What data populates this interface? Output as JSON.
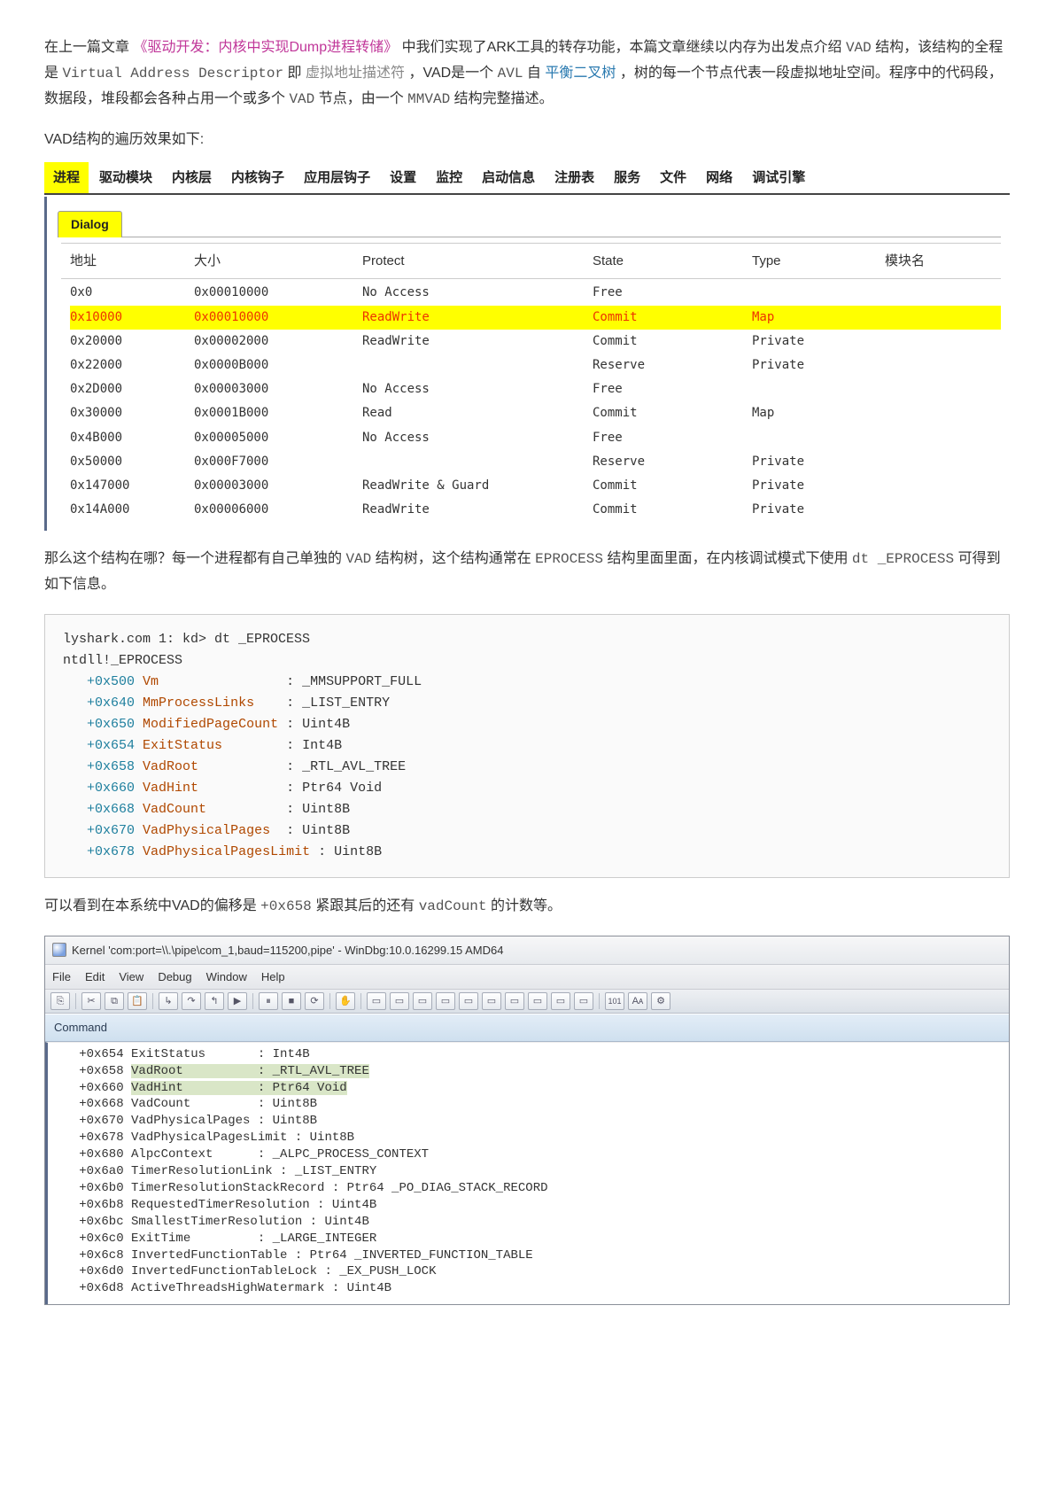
{
  "intro": {
    "line1_a": "在上一篇文章 ",
    "line1_link": "《驱动开发：内核中实现Dump进程转储》",
    "line1_b": " 中我们实现了ARK工具的转存功能，本篇文章继续以内存为出发点介绍 ",
    "vad_code": "VAD",
    "line1_c": " 结构，该结构的全程是 ",
    "vad_full": "Virtual Address Descriptor",
    "line1_d": " 即 ",
    "vad_cn": "虚拟地址描述符",
    "line1_e": " ，VAD是一个 ",
    "avl": "AVL",
    "line1_f": " 自 ",
    "balance_tree": "平衡二叉树",
    "line1_g": " ，树的每一个节点代表一段虚拟地址空间。程序中的代码段，数据段，堆段都会各种占用一个或多个 ",
    "vad_code2": "VAD",
    "line1_h": " 节点，由一个 ",
    "mmvad": "MMVAD",
    "line1_i": " 结构完整描述。"
  },
  "sub_title": "VAD结构的遍历效果如下:",
  "tabs": {
    "active": "进程",
    "items": [
      "驱动模块",
      "内核层",
      "内核钩子",
      "应用层钩子",
      "设置",
      "监控",
      "启动信息",
      "注册表",
      "服务",
      "文件",
      "网络",
      "调试引擎"
    ]
  },
  "dialog_tab": "Dialog",
  "grid": {
    "headers": [
      "地址",
      "大小",
      "Protect",
      "State",
      "Type",
      "模块名"
    ],
    "rows": [
      {
        "addr": "0x0",
        "size": "0x00010000",
        "protect": "No Access",
        "state": "Free",
        "type": "",
        "hl": false
      },
      {
        "addr": "0x10000",
        "size": "0x00010000",
        "protect": "ReadWrite",
        "state": "Commit",
        "type": "Map",
        "hl": true
      },
      {
        "addr": "0x20000",
        "size": "0x00002000",
        "protect": "ReadWrite",
        "state": "Commit",
        "type": "Private",
        "hl": false
      },
      {
        "addr": "0x22000",
        "size": "0x0000B000",
        "protect": "",
        "state": "Reserve",
        "type": "Private",
        "hl": false
      },
      {
        "addr": "0x2D000",
        "size": "0x00003000",
        "protect": "No Access",
        "state": "Free",
        "type": "",
        "hl": false
      },
      {
        "addr": "0x30000",
        "size": "0x0001B000",
        "protect": "Read",
        "state": "Commit",
        "type": "Map",
        "hl": false
      },
      {
        "addr": "0x4B000",
        "size": "0x00005000",
        "protect": "No Access",
        "state": "Free",
        "type": "",
        "hl": false
      },
      {
        "addr": "0x50000",
        "size": "0x000F7000",
        "protect": "",
        "state": "Reserve",
        "type": "Private",
        "hl": false
      },
      {
        "addr": "0x147000",
        "size": "0x00003000",
        "protect": "ReadWrite & Guard",
        "state": "Commit",
        "type": "Private",
        "hl": false
      },
      {
        "addr": "0x14A000",
        "size": "0x00006000",
        "protect": "ReadWrite",
        "state": "Commit",
        "type": "Private",
        "hl": false
      }
    ]
  },
  "para2": {
    "a": "那么这个结构在哪？每一个进程都有自己单独的 ",
    "vad": "VAD",
    "b": " 结构树，这个结构通常在 ",
    "eproc": "EPROCESS",
    "c": " 结构里面里面，在内核调试模式下使用 ",
    "dt": "dt _EPROCESS",
    "d": " 可得到如下信息。"
  },
  "code": {
    "l1": "lyshark.com 1: kd> dt _EPROCESS",
    "l2": "ntdll!_EPROCESS",
    "e": [
      {
        "off": "+0x500",
        "name": "Vm",
        "type": ": _MMSUPPORT_FULL"
      },
      {
        "off": "+0x640",
        "name": "MmProcessLinks",
        "type": ": _LIST_ENTRY"
      },
      {
        "off": "+0x650",
        "name": "ModifiedPageCount",
        "type": ": Uint4B"
      },
      {
        "off": "+0x654",
        "name": "ExitStatus",
        "type": ": Int4B"
      },
      {
        "off": "+0x658",
        "name": "VadRoot",
        "type": ": _RTL_AVL_TREE"
      },
      {
        "off": "+0x660",
        "name": "VadHint",
        "type": ": Ptr64 Void"
      },
      {
        "off": "+0x668",
        "name": "VadCount",
        "type": ": Uint8B"
      },
      {
        "off": "+0x670",
        "name": "VadPhysicalPages",
        "type": ": Uint8B"
      },
      {
        "off": "+0x678",
        "name": "VadPhysicalPagesLimit",
        "type": ": Uint8B"
      }
    ]
  },
  "para3": {
    "a": "可以看到在本系统中VAD的偏移是 ",
    "off": "+0x658",
    "b": " 紧跟其后的还有 ",
    "vc": "vadCount",
    "c": " 的计数等。"
  },
  "windbg": {
    "title": "Kernel 'com:port=\\\\.\\pipe\\com_1,baud=115200,pipe' - WinDbg:10.0.16299.15 AMD64",
    "menus": [
      "File",
      "Edit",
      "View",
      "Debug",
      "Window",
      "Help"
    ],
    "command_label": "Command",
    "lines": [
      {
        "t": "   +0x654 ExitStatus       : Int4B"
      },
      {
        "t": "   +0x658 VadRoot          : _RTL_AVL_TREE",
        "hl": true
      },
      {
        "t": "   +0x660 VadHint          : Ptr64 Void",
        "hl": true
      },
      {
        "t": "   +0x668 VadCount         : Uint8B"
      },
      {
        "t": "   +0x670 VadPhysicalPages : Uint8B"
      },
      {
        "t": "   +0x678 VadPhysicalPagesLimit : Uint8B"
      },
      {
        "t": "   +0x680 AlpcContext      : _ALPC_PROCESS_CONTEXT"
      },
      {
        "t": "   +0x6a0 TimerResolutionLink : _LIST_ENTRY"
      },
      {
        "t": "   +0x6b0 TimerResolutionStackRecord : Ptr64 _PO_DIAG_STACK_RECORD"
      },
      {
        "t": "   +0x6b8 RequestedTimerResolution : Uint4B"
      },
      {
        "t": "   +0x6bc SmallestTimerResolution : Uint4B"
      },
      {
        "t": "   +0x6c0 ExitTime         : _LARGE_INTEGER"
      },
      {
        "t": "   +0x6c8 InvertedFunctionTable : Ptr64 _INVERTED_FUNCTION_TABLE"
      },
      {
        "t": "   +0x6d0 InvertedFunctionTableLock : _EX_PUSH_LOCK"
      },
      {
        "t": "   +0x6d8 ActiveThreadsHighWatermark : Uint4B"
      }
    ]
  }
}
